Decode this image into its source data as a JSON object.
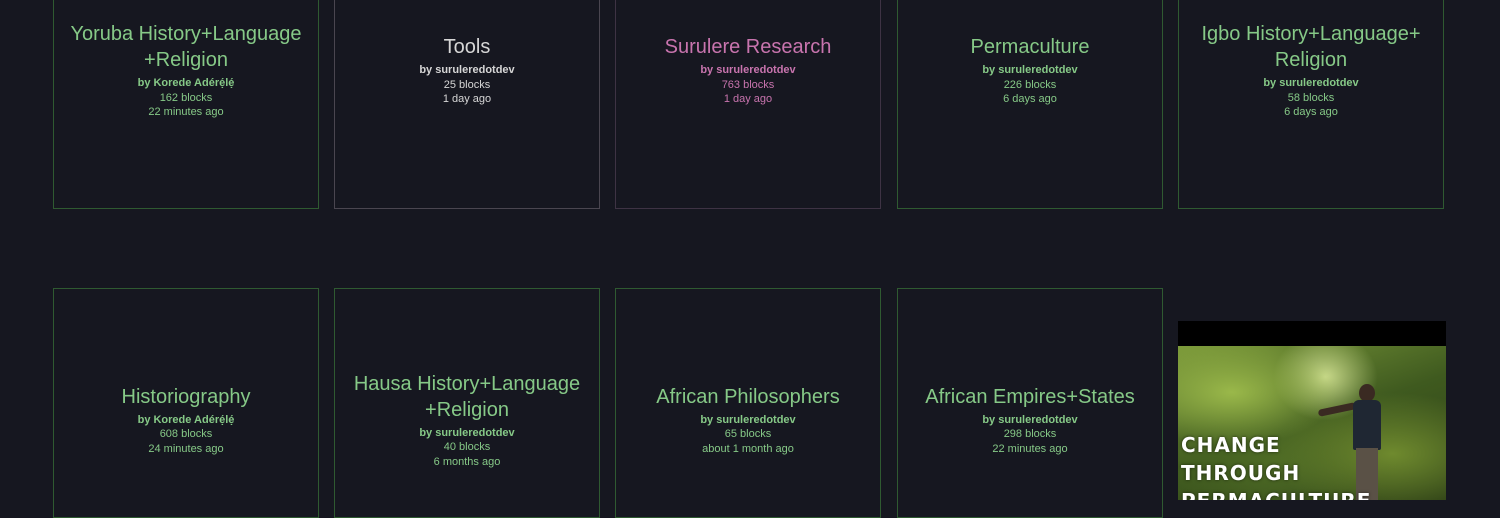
{
  "row1": [
    {
      "title": "Yoruba History+Language+Religion",
      "author": "by Korede Adérẹ́lẹ́",
      "blocks": "162 blocks",
      "updated": "22 minutes ago"
    },
    {
      "title": "Tools",
      "author": "by suruleredotdev",
      "blocks": "25 blocks",
      "updated": "1 day ago"
    },
    {
      "title": "Surulere Research",
      "author": "by suruleredotdev",
      "blocks": "763 blocks",
      "updated": "1 day ago"
    },
    {
      "title": "Permaculture",
      "author": "by suruleredotdev",
      "blocks": "226 blocks",
      "updated": "6 days ago"
    },
    {
      "title": "Igbo History+Language+Religion",
      "author": "by suruleredotdev",
      "blocks": "58 blocks",
      "updated": "6 days ago"
    }
  ],
  "row2": [
    {
      "title": "Historiography",
      "author": "by Korede Adérẹ́lẹ́",
      "blocks": "608 blocks",
      "updated": "24 minutes ago"
    },
    {
      "title": "Hausa History+Language+Religion",
      "author": "by suruleredotdev",
      "blocks": "40 blocks",
      "updated": "6 months ago"
    },
    {
      "title": "African Philosophers",
      "author": "by suruleredotdev",
      "blocks": "65 blocks",
      "updated": "about 1 month ago"
    },
    {
      "title": "African Empires+States",
      "author": "by suruleredotdev",
      "blocks": "298 blocks",
      "updated": "22 minutes ago"
    }
  ],
  "image_block": {
    "line1": "CHANGE",
    "line2": "THROUGH",
    "line3": "PERMACULTURE"
  },
  "colors": {
    "background": "#161720",
    "green": "#86c987",
    "gray": "#d6d6d6",
    "pink": "#c874ae"
  }
}
